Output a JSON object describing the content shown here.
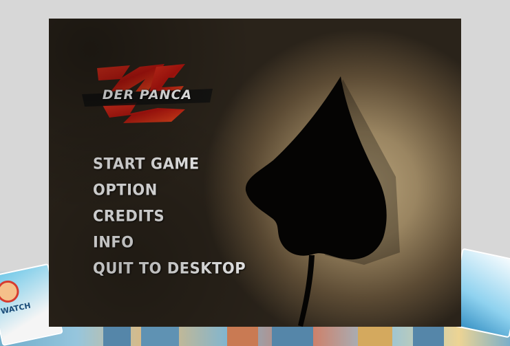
{
  "logo": {
    "text": "DER PANCA"
  },
  "menu": {
    "items": [
      {
        "label": "START GAME"
      },
      {
        "label": "OPTION"
      },
      {
        "label": "CREDITS"
      },
      {
        "label": "INFO"
      },
      {
        "label": "QUIT TO DESKTOP"
      }
    ]
  },
  "background_card_left": {
    "text": "WATCH"
  },
  "colors": {
    "page_bg": "#d7d7d7",
    "menu_text": "#f2f2f2",
    "logo_red": "#c8201a",
    "silhouette": "#050403"
  }
}
